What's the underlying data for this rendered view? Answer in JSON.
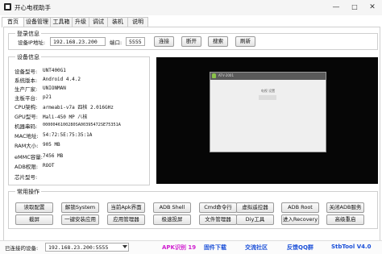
{
  "window": {
    "title": "开心电视助手",
    "minimize_glyph": "—",
    "maximize_glyph": "□",
    "close_glyph": "✕"
  },
  "tabs": [
    {
      "label": "首页"
    },
    {
      "label": "设备管理"
    },
    {
      "label": "工具箱"
    },
    {
      "label": "升级"
    },
    {
      "label": "调试"
    },
    {
      "label": "装机"
    },
    {
      "label": "说明"
    }
  ],
  "login": {
    "legend": "登录信息",
    "ip_label": "设备IP地址:",
    "ip_value": "192.168.23.200",
    "port_label": "端口:",
    "port_value": "5555",
    "connect": "连接",
    "disconnect": "断开",
    "search": "搜索",
    "refresh": "刷新"
  },
  "device_info": {
    "legend": "设备信息",
    "rows": [
      {
        "label": "设备型号:",
        "value": "UNT400G1"
      },
      {
        "label": "系统版本:",
        "value": "Android 4.4.2"
      },
      {
        "label": "生产厂家:",
        "value": "UNIONMAN"
      },
      {
        "label": "主板平台:",
        "value": "p21"
      },
      {
        "label": "CPU架构:",
        "value": "armeabi-v7a 四核 2.016GHz"
      },
      {
        "label": "GPU型号:",
        "value": "Mali-450 MP 八核"
      },
      {
        "label": "机器串码:",
        "value": "0000046100280SA00395472SE75351A"
      },
      {
        "label": "MAC地址:",
        "value": "54:72:5E:75:35:1A"
      },
      {
        "label": "RAM大小:",
        "value": "905 MB"
      },
      {
        "label": "eMMC容量:",
        "value": "7456 MB"
      },
      {
        "label": "ADB权限:",
        "value": "ROOT"
      },
      {
        "label": "芯片型号:",
        "value": ""
      }
    ]
  },
  "common_ops": {
    "legend": "常用操作",
    "row1": [
      "读取配置",
      "解锁System",
      "当前Apk界面",
      "ADB Shell",
      "Cmd命令行",
      "虚拟遥控器",
      "ADB Root",
      "关闭ADB服务"
    ],
    "row2": [
      "截屏",
      "一键安装应用",
      "应用管理器",
      "极速投屏",
      "文件管理器",
      "Diy工具",
      "进入Recovery",
      "高级重启"
    ]
  },
  "screen_preview": {
    "device_label": "ATV-2001",
    "center_text": "电视 设置"
  },
  "status_bar": {
    "label": "已连接的设备:",
    "device_value": "192.168.23.200:5555",
    "links": [
      {
        "text": "APK识别 19",
        "color": "#d020d0"
      },
      {
        "text": "固件下载",
        "color": "#1a4fd8"
      },
      {
        "text": "交流社区",
        "color": "#1a4fd8"
      },
      {
        "text": "反馈QQ群",
        "color": "#1a4fd8"
      },
      {
        "text": "StbTool V4.0",
        "color": "#1a4fd8"
      }
    ]
  }
}
